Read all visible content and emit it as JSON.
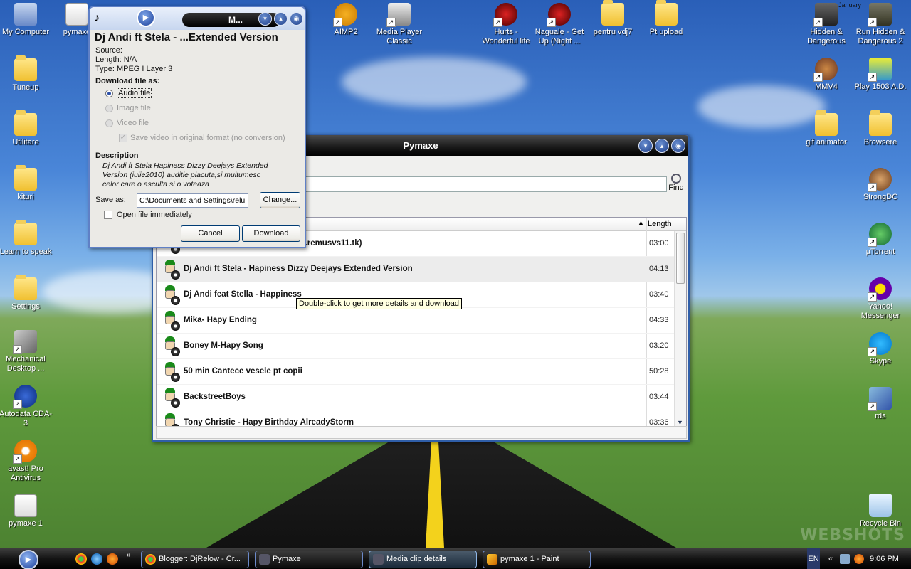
{
  "desktop": {
    "left_icons": [
      {
        "label": "My Computer"
      },
      {
        "label": "Tuneup"
      },
      {
        "label": "Utilitare"
      },
      {
        "label": "kituri"
      },
      {
        "label": "Learn to speak"
      },
      {
        "label": "Settings"
      },
      {
        "label": "Mechanical Desktop ..."
      },
      {
        "label": "Autodata CDA-3"
      },
      {
        "label": "avast! Pro Antivirus"
      },
      {
        "label": "pymaxe 1"
      }
    ],
    "top_icons": [
      {
        "label": "pymaxe"
      },
      {
        "label": "AIMP2"
      },
      {
        "label": "Media Player Classic"
      },
      {
        "label": "Hurts - Wonderful life"
      },
      {
        "label": "Naguale - Get Up (Night ..."
      },
      {
        "label": "pentru vdj7"
      },
      {
        "label": "Pt upload"
      }
    ],
    "right_icons": [
      {
        "label": "Hidden & Dangerous"
      },
      {
        "label": "Run Hidden & Dangerous 2"
      },
      {
        "label": "MMV4"
      },
      {
        "label": "Play 1503 A.D."
      },
      {
        "label": "gif animator"
      },
      {
        "label": "Browsere"
      },
      {
        "label": "StrongDC"
      },
      {
        "label": "µTorrent"
      },
      {
        "label": "Yahoo! Messenger"
      },
      {
        "label": "Skype"
      },
      {
        "label": "rds"
      },
      {
        "label": "Recycle Bin"
      }
    ],
    "calendar_month": "January",
    "watermark": "WEBSHOTS"
  },
  "pymaxe": {
    "title": "Pymaxe",
    "find_label": "Find",
    "search_value": "",
    "column_length": "Length",
    "rows": [
      {
        "title": "w.remusvs11.tk)",
        "length": "03:00"
      },
      {
        "title": "Dj Andi ft Stela  -  Hapiness  Dizzy Deejays Extended Version",
        "length": "04:13"
      },
      {
        "title": "Dj Andi feat  Stella - Happiness",
        "length": "03:40"
      },
      {
        "title": "Mika- Hapy Ending",
        "length": "04:33"
      },
      {
        "title": "Boney M-Hapy Song",
        "length": "03:20"
      },
      {
        "title": "50 min Cantece vesele pt copii",
        "length": "50:28"
      },
      {
        "title": "BackstreetBoys",
        "length": "03:44"
      },
      {
        "title": "Tony Christie   -  Hapy Birthday   AlreadyStorm",
        "length": "03:36"
      }
    ],
    "tooltip": "Double-click to get more details and download"
  },
  "details": {
    "title_short": "M...",
    "heading": "Dj Andi ft Stela  -  ...Extended Version",
    "source": "Source:",
    "length": "Length: N/A",
    "type": "Type:  MPEG I Layer 3",
    "download_as_label": "Download file as:",
    "opt_audio": "Audio file",
    "opt_image": "Image file",
    "opt_video": "Video file",
    "opt_save_original": "Save video in original format (no conversion)",
    "description_label": "Description",
    "description_text": "Dj Andi ft Stela  Hapiness  Dizzy Deejays Extended Version  (iulie2010) auditie placuta,si multumesc celor care o asculta si o voteaza",
    "save_as_label": "Save as:",
    "save_as_value": "C:\\Documents and Settings\\relu",
    "change_button": "Change...",
    "open_immediately": "Open file immediately",
    "cancel_button": "Cancel",
    "download_button": "Download"
  },
  "taskbar": {
    "tasks": [
      {
        "label": "Blogger: DjRelow - Cr..."
      },
      {
        "label": "Pymaxe"
      },
      {
        "label": "Media clip details"
      },
      {
        "label": "pymaxe 1 - Paint"
      }
    ],
    "language": "EN",
    "clock": "9:06 PM"
  }
}
